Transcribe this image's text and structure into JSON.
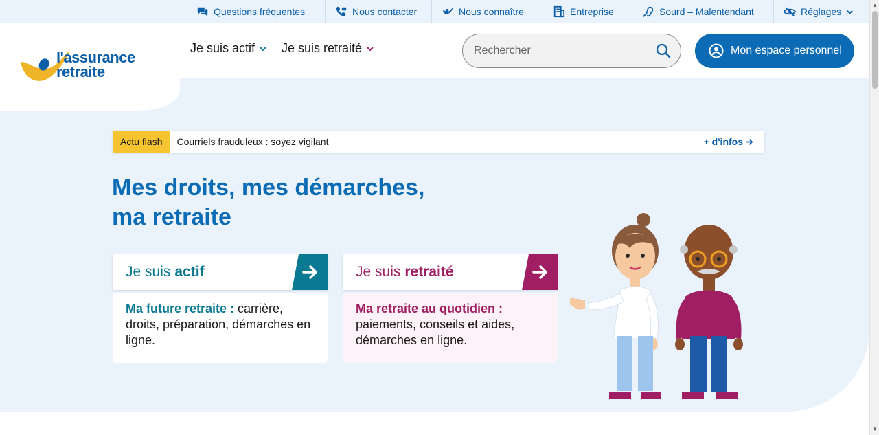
{
  "topbar": {
    "items": [
      {
        "label": "Questions fréquentes",
        "icon": "chat-icon"
      },
      {
        "label": "Nous contacter",
        "icon": "phone-icon"
      },
      {
        "label": "Nous connaître",
        "icon": "logo-mark-icon"
      },
      {
        "label": "Entreprise",
        "icon": "building-icon"
      },
      {
        "label": "Sourd – Malentendant",
        "icon": "ear-icon"
      },
      {
        "label": "Réglages",
        "icon": "eye-off-icon"
      }
    ]
  },
  "header": {
    "logo_line1": "l'assurance",
    "logo_line2": "retraite",
    "nav": [
      {
        "label": "Je suis actif",
        "color": "#0a7a93"
      },
      {
        "label": "Je suis retraité",
        "color": "#a01e64"
      }
    ],
    "search_placeholder": "Rechercher",
    "espace_label": "Mon espace personnel"
  },
  "flash": {
    "tag": "Actu flash",
    "message": "Courriels frauduleux : soyez vigilant",
    "more": "+ d'infos"
  },
  "hero": {
    "title_line1": "Mes droits, mes démarches,",
    "title_line2": "ma retraite"
  },
  "cards": {
    "actif": {
      "prefix": "Je suis",
      "bold": "actif",
      "lead": "Ma future retraite :",
      "text": " carrière, droits, préparation, démarches en ligne."
    },
    "retraite": {
      "prefix": "Je suis",
      "bold": "retraité",
      "lead": "Ma retraite au quotidien :",
      "text": " paiements, conseils et aides, démarches en ligne."
    }
  },
  "colors": {
    "brand_blue": "#0b6cb5",
    "actif_teal": "#0a7a93",
    "retraite_purple": "#a01e64",
    "flash_yellow": "#f6c431",
    "hero_bg": "#eaf3fc"
  }
}
